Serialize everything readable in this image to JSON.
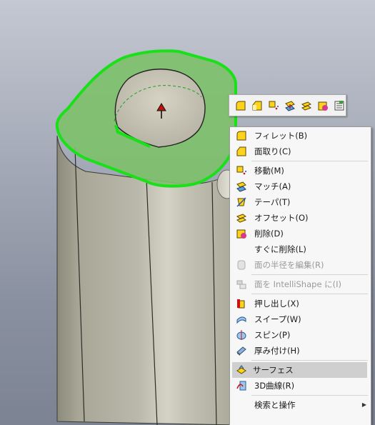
{
  "mini_toolbar": {
    "buttons": [
      "fillet-icon",
      "chamfer-icon",
      "move-icon",
      "match-icon",
      "offset-icon",
      "delete-icon",
      "properties-icon"
    ]
  },
  "context_menu": {
    "items": [
      {
        "label": "フィレット(B)",
        "icon": "fillet-icon",
        "enabled": true
      },
      {
        "label": "面取り(C)",
        "icon": "chamfer-icon",
        "enabled": true
      },
      {
        "label": "移動(M)",
        "icon": "move-icon",
        "enabled": true
      },
      {
        "label": "マッチ(A)",
        "icon": "match-icon",
        "enabled": true
      },
      {
        "label": "テーパ(T)",
        "icon": "taper-icon",
        "enabled": true
      },
      {
        "label": "オフセット(O)",
        "icon": "offset-icon",
        "enabled": true
      },
      {
        "label": "削除(D)",
        "icon": "delete-icon",
        "enabled": true
      },
      {
        "label": "すぐに削除(L)",
        "icon": "",
        "enabled": true
      },
      {
        "label": "面の半径を編集(R)",
        "icon": "edit-radius-icon",
        "enabled": false
      },
      {
        "label": "面を IntelliShape に(I)",
        "icon": "intellishape-icon",
        "enabled": false
      },
      {
        "label": "押し出し(X)",
        "icon": "extrude-icon",
        "enabled": true
      },
      {
        "label": "スイープ(W)",
        "icon": "sweep-icon",
        "enabled": true
      },
      {
        "label": "スピン(P)",
        "icon": "spin-icon",
        "enabled": true
      },
      {
        "label": "厚み付け(H)",
        "icon": "thicken-icon",
        "enabled": true
      },
      {
        "label": "サーフェス",
        "icon": "surface-icon",
        "enabled": true,
        "highlighted": true
      },
      {
        "label": "3D曲線(R)",
        "icon": "3d-curve-icon",
        "enabled": true
      },
      {
        "label": "検索と操作",
        "icon": "",
        "enabled": true,
        "submenu": true
      }
    ]
  },
  "colors": {
    "selection_green": "#22dd22",
    "menu_bg": "#f7f7f7",
    "highlight_bg": "#cfcfcf",
    "icon_yellow": "#ffd21c"
  }
}
